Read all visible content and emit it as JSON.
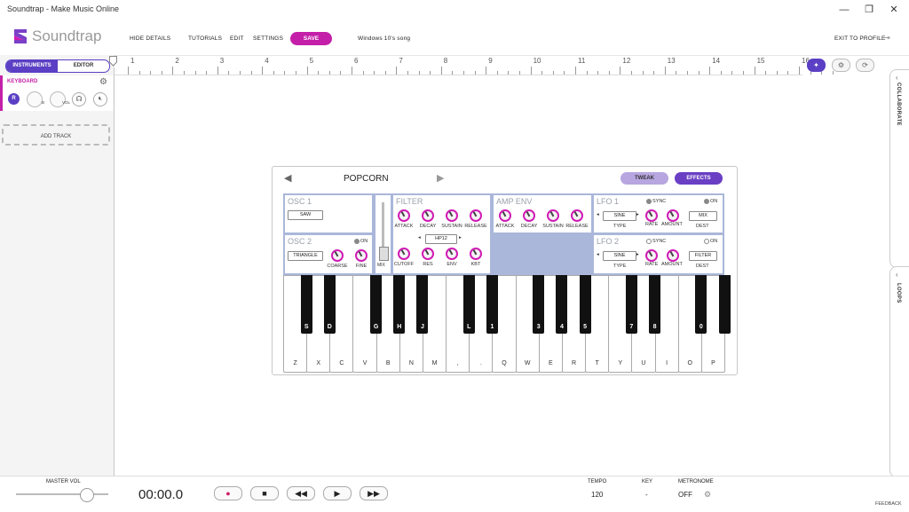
{
  "window": {
    "title": "Soundtrap - Make Music Online",
    "minimize": "—",
    "restore": "❐",
    "close": "✕"
  },
  "header": {
    "logo_text": "Soundtrap",
    "hide_details": "HIDE DETAILS",
    "tutorials": "TUTORIALS",
    "edit": "EDIT",
    "settings": "SETTINGS",
    "save": "SAVE",
    "song_name": "Windows 10's song",
    "exit": "EXIT TO PROFILE",
    "accent": "#c41fa9"
  },
  "left": {
    "tabs": [
      "INSTRUMENTS",
      "EDITOR"
    ],
    "track": {
      "name": "KEYBOARD",
      "record": "R",
      "pan_label": "B",
      "vol_label": "VOL"
    },
    "add_track": "ADD TRACK"
  },
  "ruler": {
    "marks": [
      "1",
      "2",
      "3",
      "4",
      "5",
      "6",
      "7",
      "8",
      "9",
      "10",
      "11",
      "12",
      "13",
      "14",
      "15",
      "16"
    ]
  },
  "rail": {
    "collaborate": "COLLABORATE",
    "loops": "LOOPS"
  },
  "synth": {
    "preset": "POPCORN",
    "tweak": "TWEAK",
    "effects": "EFFECTS",
    "osc1": {
      "title": "OSC 1",
      "wave": "SAW"
    },
    "osc2": {
      "title": "OSC 2",
      "on": "ON",
      "wave": "TRIANGLE",
      "coarse": "COARSE",
      "fine": "FINE"
    },
    "mix_label": "MIX",
    "filter": {
      "title": "FILTER",
      "attack": "ATTACK",
      "decay": "DECAY",
      "sustain": "SUSTAIN",
      "release": "RELEASE",
      "type": "HP12",
      "cutoff": "CUTOFF",
      "res": "RES",
      "env": "ENV",
      "kbt": "KBT"
    },
    "ampenv": {
      "title": "AMP ENV",
      "attack": "ATTACK",
      "decay": "DECAY",
      "sustain": "SUSTAIN",
      "release": "RELEASE"
    },
    "lfo1": {
      "title": "LFO 1",
      "sync": "SYNC",
      "on": "ON",
      "type_value": "SINE",
      "type": "TYPE",
      "rate": "RATE",
      "amount": "AMOUNT",
      "dest_value": "MIX",
      "dest": "DEST"
    },
    "lfo2": {
      "title": "LFO 2",
      "sync": "SYNC",
      "on": "ON",
      "type_value": "SINE",
      "type": "TYPE",
      "rate": "RATE",
      "amount": "AMOUNT",
      "dest_value": "FILTER",
      "dest": "DEST"
    },
    "white_keys": [
      "Z",
      "X",
      "C",
      "V",
      "B",
      "N",
      "M",
      ",",
      ".",
      "Q",
      "W",
      "E",
      "R",
      "T",
      "Y",
      "U",
      "I",
      "O",
      "P"
    ],
    "black_keys": [
      "S",
      "D",
      "G",
      "H",
      "J",
      "L",
      "1",
      "3",
      "4",
      "5",
      "7",
      "8",
      "0",
      ""
    ]
  },
  "transport": {
    "master_vol": "MASTER VOL",
    "time": "00:00.0",
    "tempo_label": "TEMPO",
    "tempo": "120",
    "key_label": "KEY",
    "key": "-",
    "metronome_label": "METRONOME",
    "metronome": "OFF",
    "feedback": "FEEDBACK"
  }
}
